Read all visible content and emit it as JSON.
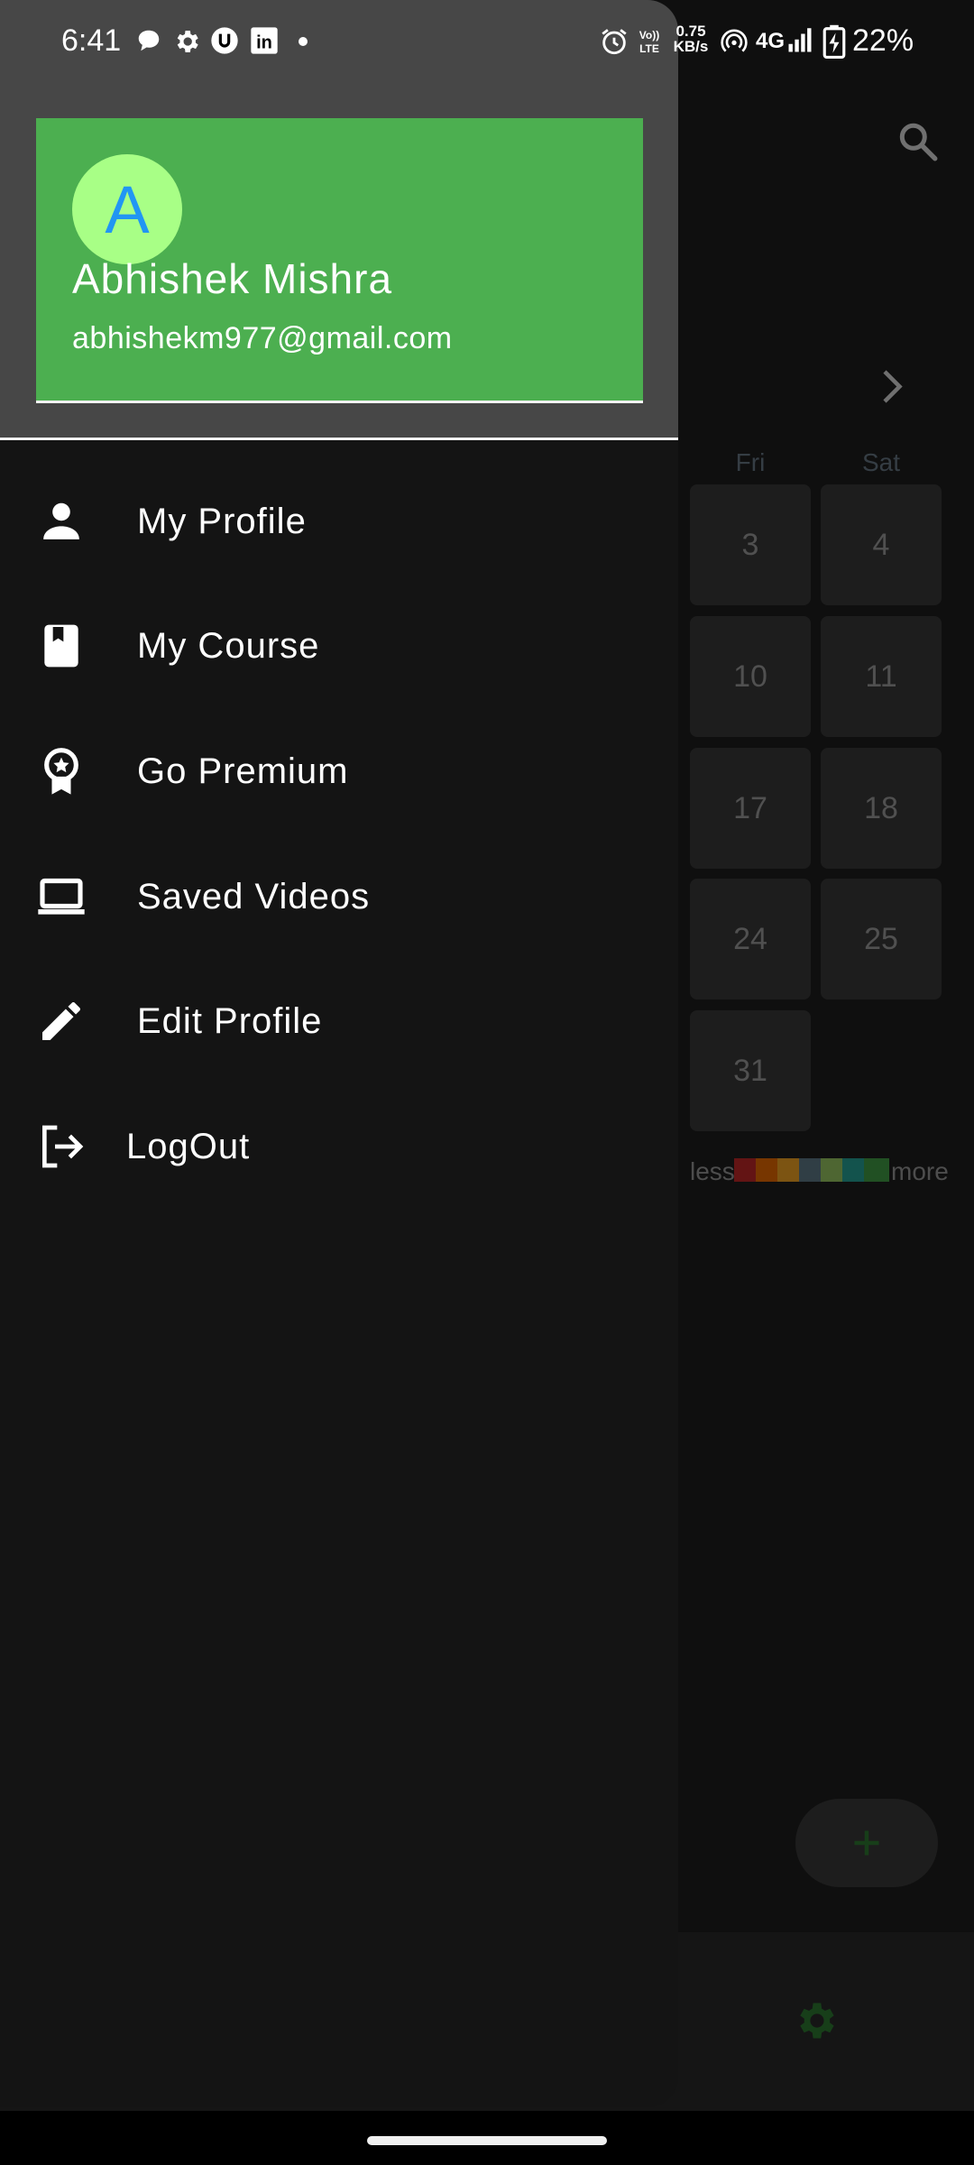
{
  "status_bar": {
    "time": "6:41",
    "net_speed_value": "0.75",
    "net_speed_unit": "KB/s",
    "network": "4G",
    "battery": "22%",
    "volte_top": "Vo))",
    "volte_bottom": "LTE",
    "linkedin": "in",
    "notification_icons": [
      "chat-bubble-icon",
      "gear-icon",
      "u-badge-icon",
      "linkedin-icon",
      "dot-icon"
    ],
    "right_icons": [
      "alarm-icon",
      "volte-icon",
      "hotspot-icon",
      "signal-icon",
      "battery-charging-icon"
    ]
  },
  "drawer": {
    "avatar_letter": "A",
    "name": "Abhishek Mishra",
    "email": "abhishekm977@gmail.com",
    "menu": [
      {
        "label": "My Profile",
        "icon": "person-icon"
      },
      {
        "label": "My Course",
        "icon": "book-icon"
      },
      {
        "label": "Go Premium",
        "icon": "award-icon"
      },
      {
        "label": "Saved Videos",
        "icon": "laptop-icon"
      },
      {
        "label": "Edit Profile",
        "icon": "pencil-icon"
      },
      {
        "label": "LogOut",
        "icon": "logout-icon"
      }
    ]
  },
  "background": {
    "weekdays": [
      "Fri",
      "Sat"
    ],
    "calendar_rows": [
      [
        "3",
        "4"
      ],
      [
        "10",
        "11"
      ],
      [
        "17",
        "18"
      ],
      [
        "24",
        "25"
      ],
      [
        "31"
      ]
    ],
    "legend_less": "less",
    "legend_more": "more",
    "legend_colors": [
      "#c62828",
      "#ef6c00",
      "#f9a825",
      "#607d8b",
      "#9ccc65",
      "#26a69a",
      "#43a047"
    ],
    "fab_icon": "plus-icon",
    "settings_icon": "gear-icon",
    "accent_green": "#2e7d32"
  },
  "colors": {
    "header_card": "#4caf50",
    "avatar_bg": "#a8ff86",
    "avatar_letter": "#2196f3",
    "drawer_bg": "#141414"
  }
}
